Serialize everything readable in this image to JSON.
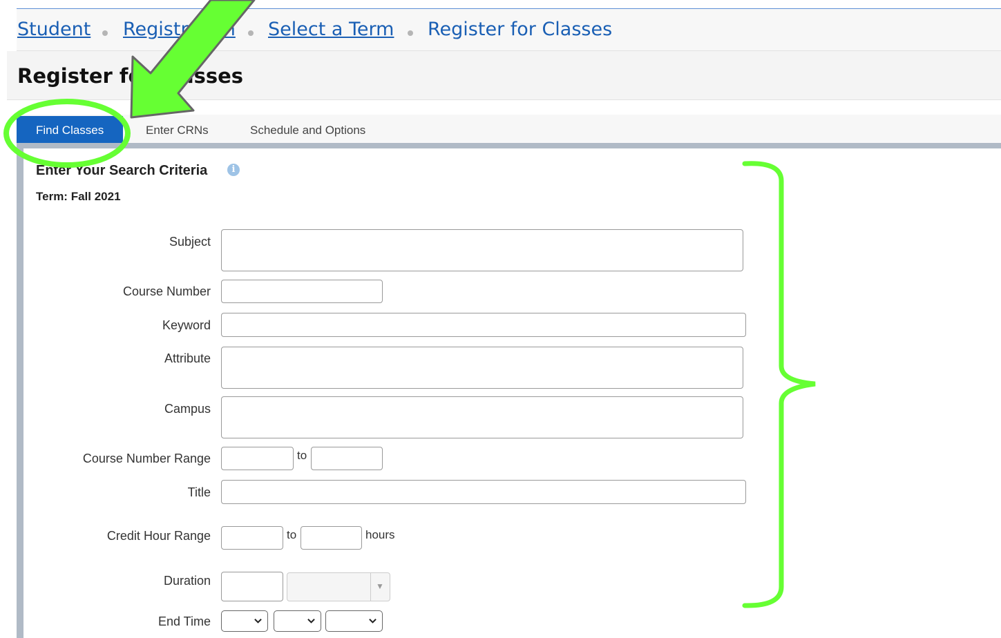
{
  "breadcrumb": {
    "items": [
      "Student",
      "Registration",
      "Select a Term"
    ],
    "current": "Register for Classes"
  },
  "page_title": "Register for Classes",
  "tabs": [
    {
      "label": "Find Classes",
      "active": true
    },
    {
      "label": "Enter CRNs",
      "active": false
    },
    {
      "label": "Schedule and Options",
      "active": false
    }
  ],
  "search": {
    "heading": "Enter Your Search Criteria",
    "term": "Term: Fall 2021",
    "fields": {
      "subject": "Subject",
      "course_number": "Course Number",
      "keyword": "Keyword",
      "attribute": "Attribute",
      "campus": "Campus",
      "course_number_range": "Course Number Range",
      "title": "Title",
      "credit_hour_range": "Credit Hour Range",
      "duration": "Duration",
      "end_time": "End Time"
    },
    "to": "to",
    "hours": "hours"
  },
  "colors": {
    "link": "#1a5fb4",
    "active_tab": "#1565c0",
    "annotation": "#66ff33"
  },
  "icons": {
    "info": "info-icon",
    "annotation_arrow": "arrow-annotation",
    "annotation_circle": "circle-annotation",
    "annotation_brace": "brace-annotation"
  }
}
